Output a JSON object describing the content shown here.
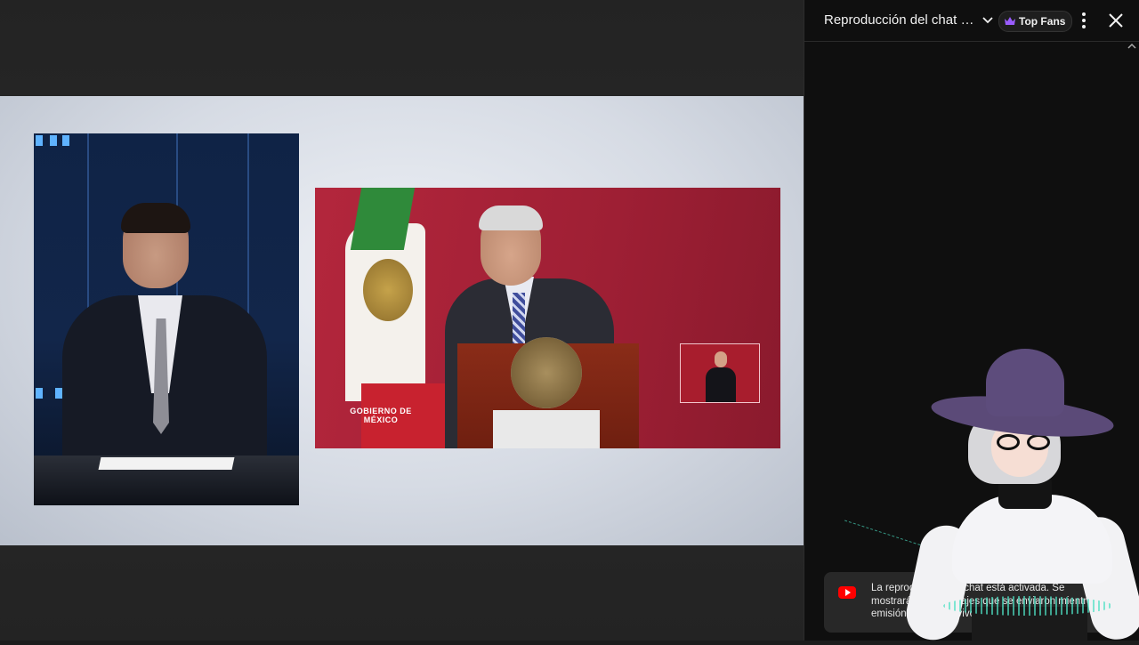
{
  "chat": {
    "title": "Reproducción del chat d...",
    "badge_label": "Top Fans",
    "notice_text": "La reproducción del chat está activada. Se mostrarán los mensajes que se enviaron mientras la emisión estaba en vivo."
  },
  "video": {
    "flag_caption": "GOBIERNO DE MÉXICO"
  },
  "colors": {
    "chat_bg": "#0f0f0f",
    "badge_crown": "#9a5cff",
    "youtube_red": "#ff0000"
  },
  "icons": [
    "chevron-down-icon",
    "crown-icon",
    "more-vert-icon",
    "close-icon",
    "youtube-icon",
    "scroll-up-icon"
  ]
}
